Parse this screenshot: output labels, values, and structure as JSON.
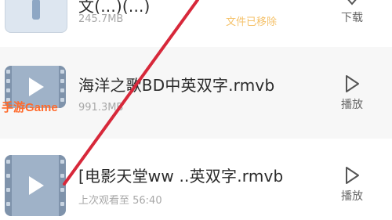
{
  "items": [
    {
      "title": "文(...)(...)",
      "size": "245.7MB",
      "status": "文件已移除",
      "action_label": "下载",
      "thumb_icon": "zip-file-icon",
      "action_icon": "download-icon"
    },
    {
      "title": "海洋之歌BD中英双字.rmvb",
      "size": "991.3MB",
      "action_label": "播放",
      "thumb_icon": "video-file-icon",
      "action_icon": "play-icon"
    },
    {
      "title": "[电影天堂ww ..英双字.rmvb",
      "last_watched": "上次观看至 56:40",
      "action_label": "播放",
      "thumb_icon": "video-file-icon",
      "action_icon": "play-icon"
    }
  ],
  "watermark": {
    "text": "手游Game",
    "color": "#ff6a2b"
  },
  "annotation": {
    "color": "#d7283a",
    "shape": "diagonal-line"
  },
  "colors": {
    "title_text": "#2b2b2b",
    "meta_text": "#a8a8a8",
    "removed_status": "#f5c26b",
    "thumbnail": "#9fb2c8"
  }
}
